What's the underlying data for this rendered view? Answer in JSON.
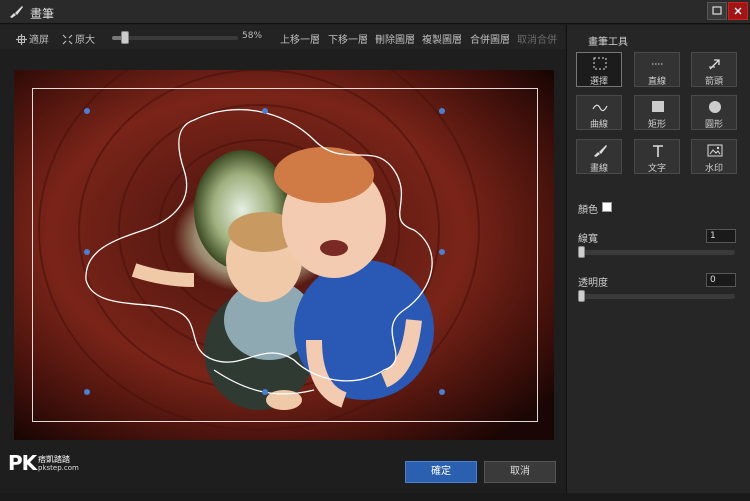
{
  "window": {
    "title": "畫筆"
  },
  "toolbar": {
    "fit_label": "適屏",
    "original_label": "原大",
    "zoom_value": "58%",
    "zoom_fraction": 0.1,
    "layer_up": "上移一層",
    "layer_down": "下移一層",
    "delete_layer": "刪除圖層",
    "copy_layer": "複製圖層",
    "merge_layers": "合併圖層",
    "undo_merge": "取消合併"
  },
  "panel": {
    "title": "畫筆工具",
    "tools": [
      {
        "label": "選擇",
        "icon": "select-icon",
        "active": true
      },
      {
        "label": "直線",
        "icon": "line-icon",
        "active": false
      },
      {
        "label": "箭頭",
        "icon": "arrow-icon",
        "active": false
      },
      {
        "label": "曲線",
        "icon": "curve-icon",
        "active": false
      },
      {
        "label": "矩形",
        "icon": "rectangle-icon",
        "active": false
      },
      {
        "label": "圓形",
        "icon": "circle-icon",
        "active": false
      },
      {
        "label": "畫線",
        "icon": "brush-icon",
        "active": false
      },
      {
        "label": "文字",
        "icon": "text-icon",
        "active": false
      },
      {
        "label": "水印",
        "icon": "watermark-icon",
        "active": false
      }
    ],
    "color_label": "顏色",
    "color_value": "#ffffff",
    "line_width_label": "線寬",
    "line_width_value": "1",
    "line_width_fraction": 0.0,
    "opacity_label": "透明度",
    "opacity_value": "0",
    "opacity_fraction": 0.0
  },
  "actions": {
    "ok": "確定",
    "cancel": "取消"
  },
  "watermark": {
    "logo": "PK",
    "line1": "痞凱踏踏",
    "line2": "pkstep.com"
  },
  "colors": {
    "accent": "#2b5fb0",
    "handle": "#4a7fd6",
    "close": "#a11515"
  }
}
